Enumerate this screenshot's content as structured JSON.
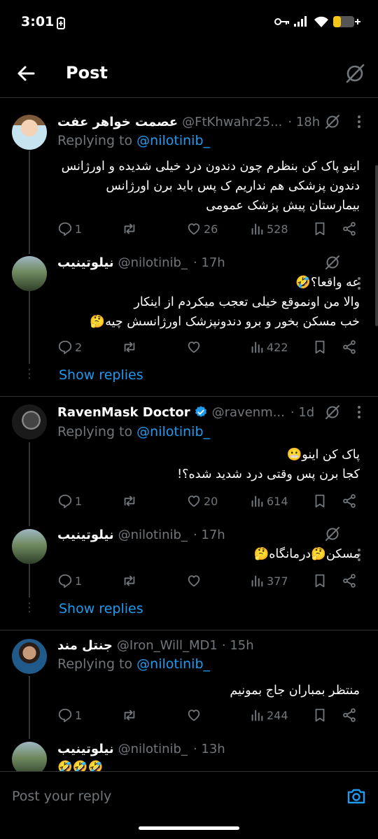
{
  "status_bar": {
    "time": "3:01"
  },
  "header": {
    "title": "Post"
  },
  "tweets": [
    {
      "display_name": "عصمت خواهر عفت",
      "handle": "@FtKhwahr25...",
      "time": "· 18h",
      "replying_label": "Replying to",
      "replying_to": "@nilotinib_",
      "lines": [
        "اینو پاک کن بنظرم چون دندون درد خیلی شدیده و اورژانس",
        "دندون پزشکی هم نداریم ک پس باید برن اورژانس",
        "بیمارستان پیش پزشک عمومی"
      ],
      "replies": "1",
      "retweets": "",
      "likes": "26",
      "views": "528"
    },
    {
      "display_name": "نیلوتینیب",
      "handle": "@nilotinib_",
      "time": "· 17h",
      "lines": [
        "عه واقعا؟🤣",
        "والا من اونموقع خیلی تعجب میکردم از اینکار",
        "خب مسکن بخور و برو دندونپزشک اورژانسش چیه🤔"
      ],
      "replies": "2",
      "retweets": "",
      "likes": "",
      "views": "422",
      "show_replies": "Show replies"
    },
    {
      "display_name": "RavenMask Doctor",
      "handle": "@ravenm...",
      "time": "· 1d",
      "replying_label": "Replying to",
      "replying_to": "@nilotinib_",
      "lines": [
        "پاک کن اینو😬",
        "کجا برن پس وقتی درد شدید شده؟!"
      ],
      "replies": "1",
      "retweets": "",
      "likes": "20",
      "views": "614"
    },
    {
      "display_name": "نیلوتینیب",
      "handle": "@nilotinib_",
      "time": "· 17h",
      "lines": [
        "مسکن🤔درمانگاه🤔"
      ],
      "replies": "1",
      "retweets": "",
      "likes": "",
      "views": "377",
      "show_replies": "Show replies"
    },
    {
      "display_name": "جنتل مند",
      "handle": "@Iron_Will_MD1",
      "time": "· 15h",
      "replying_label": "Replying to",
      "replying_to": "@nilotinib_",
      "lines": [
        "منتظر بمباران جاج بمونیم"
      ],
      "replies": "1",
      "retweets": "",
      "likes": "",
      "views": "244"
    },
    {
      "display_name": "نیلوتینیب",
      "handle": "@nilotinib_",
      "time": "· 13h",
      "lines": [
        "🤣🤣🤣"
      ]
    }
  ],
  "reply_bar": {
    "placeholder": "Post your reply"
  },
  "colors": {
    "background": "#000000",
    "accent": "#1d9bf0",
    "muted": "#71767b",
    "verified": "#1d9bf0"
  },
  "icons": [
    "back-arrow-icon",
    "grok-icon",
    "more-icon",
    "reply-icon",
    "retweet-icon",
    "like-icon",
    "views-icon",
    "bookmark-icon",
    "share-icon",
    "camera-icon",
    "verified-icon"
  ]
}
